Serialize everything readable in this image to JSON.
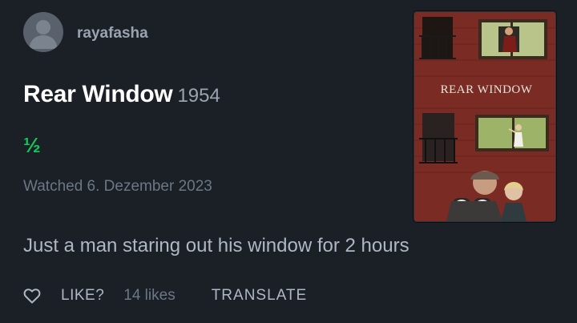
{
  "review": {
    "username": "rayafasha",
    "film_title": "Rear Window",
    "film_year": "1954",
    "rating": "½",
    "watched": "Watched 6. Dezember 2023",
    "text": "Just a man staring out his window for 2 hours"
  },
  "poster": {
    "title_text": "Rear Window"
  },
  "actions": {
    "like_label": "LIKE?",
    "likes_count": "14 likes",
    "translate_label": "TRANSLATE"
  },
  "colors": {
    "background": "#1b1f26",
    "rating_green": "#14c65a",
    "muted_text": "#6c7786"
  }
}
